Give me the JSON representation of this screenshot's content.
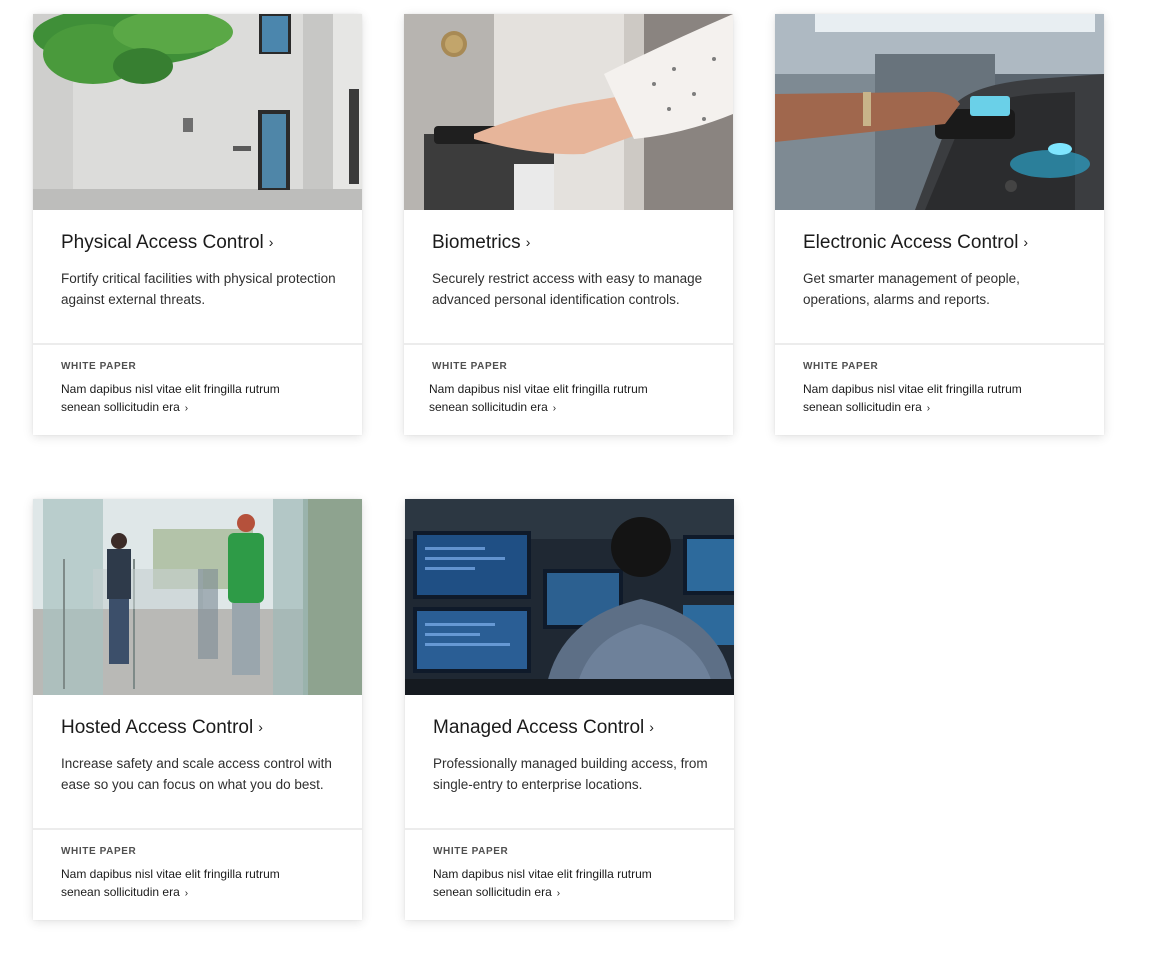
{
  "cards": [
    {
      "title": "Physical Access Control",
      "chevron": "›",
      "description": "Fortify critical facilities with physical protection against external threats.",
      "tag": "WHITE PAPER",
      "link_text": "Nam dapibus nisl vitae elit fringilla rutrum senean sollicitudin era",
      "link_chevron": "›",
      "image": "building-facade-image"
    },
    {
      "title": "Biometrics",
      "chevron": "›",
      "description": "Securely restrict access with easy to manage advanced personal identification controls.",
      "tag": "WHITE PAPER",
      "link_text": "Nam dapibus nisl vitae elit fringilla rutrum senean sollicitudin era",
      "link_chevron": "›",
      "image": "fingerprint-scanner-image"
    },
    {
      "title": "Electronic Access Control",
      "chevron": "›",
      "description": "Get smarter management of people, operations, alarms and reports.",
      "tag": "WHITE PAPER",
      "link_text": "Nam dapibus nisl vitae elit fringilla rutrum senean sollicitudin era",
      "link_chevron": "›",
      "image": "turnstile-card-reader-image"
    },
    {
      "title": "Hosted Access Control",
      "chevron": "›",
      "description": "Increase safety and scale access control with ease so you can focus on what you do best.",
      "tag": "WHITE PAPER",
      "link_text": "Nam dapibus nisl vitae elit fringilla rutrum senean sollicitudin era",
      "link_chevron": "›",
      "image": "glass-gates-lobby-image"
    },
    {
      "title": "Managed Access Control",
      "chevron": "›",
      "description": "Professionally managed building access, from single-entry to enterprise locations.",
      "tag": "WHITE PAPER",
      "link_text": "Nam dapibus nisl vitae elit fringilla rutrum senean sollicitudin era",
      "link_chevron": "›",
      "image": "security-operations-center-image"
    }
  ]
}
